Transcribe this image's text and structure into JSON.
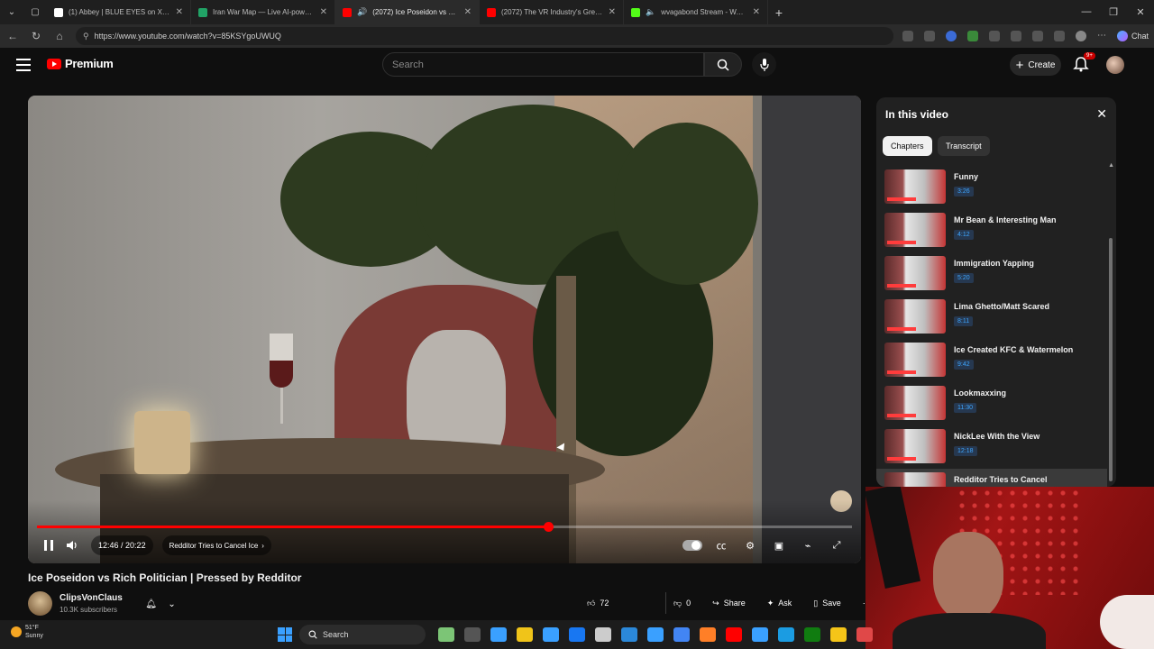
{
  "browser": {
    "tabs": [
      {
        "title": "(1) Abbey | BLUE EYES on X: \"The ",
        "color": "#ffffff",
        "active": false
      },
      {
        "title": "Iran War Map — Live AI-powered",
        "color": "#21a366",
        "active": false
      },
      {
        "title": "(2072) Ice Poseidon vs Rich Po",
        "color": "#ff0000",
        "active": true
      },
      {
        "title": "(2072) The VR Industry's Great Re",
        "color": "#ff0000",
        "active": false
      },
      {
        "title": "wvagabond Stream - Watch L",
        "color": "#53fc18",
        "active": false
      }
    ],
    "url": "https://www.youtube.com/watch?v=85KSYgoUWUQ",
    "chat_label": "Chat"
  },
  "yt": {
    "logo": "Premium",
    "search_placeholder": "Search",
    "create_label": "Create",
    "notif_badge": "9+"
  },
  "player": {
    "current_time": "12:46",
    "duration": "20:22",
    "progress_fraction": 0.627,
    "chapter_label": "Redditor Tries to Cancel Ice"
  },
  "video": {
    "title": "Ice Poseidon vs Rich Politician | Pressed by Redditor",
    "channel": "ClipsVonClaus",
    "subscribers": "10.3K subscribers",
    "likes": "72",
    "dislikes": "0",
    "share": "Share",
    "ask": "Ask",
    "save": "Save"
  },
  "panel": {
    "title": "In this video",
    "chip_chapters": "Chapters",
    "chip_transcript": "Transcript",
    "chapters": [
      {
        "title": "Funny",
        "time": "3:26"
      },
      {
        "title": "Mr Bean & Interesting Man",
        "time": "4:12"
      },
      {
        "title": "Immigration Yapping",
        "time": "5:20"
      },
      {
        "title": "Lima Ghetto/Matt Scared",
        "time": "8:11"
      },
      {
        "title": "Ice Created KFC & Watermelon",
        "time": "9:42"
      },
      {
        "title": "Lookmaxxing",
        "time": "11:30"
      },
      {
        "title": "NickLee With the View",
        "time": "12:18"
      },
      {
        "title": "Redditor Tries to Cancel",
        "time": ""
      }
    ]
  },
  "taskbar": {
    "temp": "51°F",
    "condition": "Sunny",
    "search": "Search",
    "app_colors": [
      "#7cc576",
      "#555555",
      "#3aa0ff",
      "#f0c419",
      "#3aa0ff",
      "#1877f2",
      "#cccccc",
      "#2b88d9",
      "#3aa0ff",
      "#4285f4",
      "#ff7f27",
      "#ff0000",
      "#3aa0ff",
      "#1b9ce2",
      "#107c10",
      "#f5c518",
      "#e04848"
    ]
  }
}
